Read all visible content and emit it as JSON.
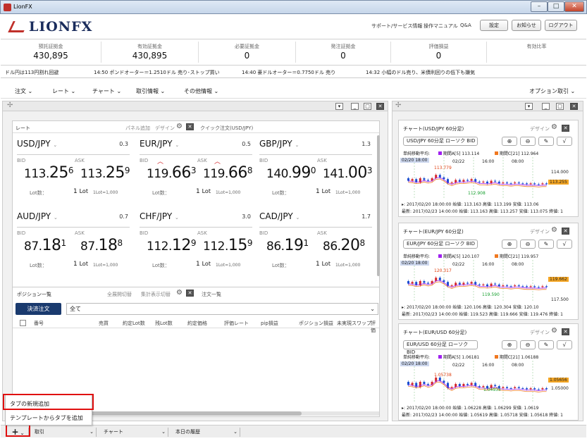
{
  "window": {
    "title": "LionFX"
  },
  "header": {
    "logo": "LIONFX",
    "links": [
      "サポート/サービス情報",
      "操作マニュアル",
      "Q&A"
    ],
    "buttons": [
      "設定",
      "お知らせ",
      "ログアウト"
    ]
  },
  "summary": [
    {
      "label": "預託証拠金",
      "value": "430,895"
    },
    {
      "label": "有効証拠金",
      "value": "430,895"
    },
    {
      "label": "必要証拠金",
      "value": "0"
    },
    {
      "label": "発注証拠金",
      "value": "0"
    },
    {
      "label": "評価損益",
      "value": "0"
    },
    {
      "label": "有効比率",
      "value": ""
    }
  ],
  "ticker": [
    "ドル円は113円割れ回避",
    "14:50  ポンドオーター＝1.2510ドル 売り･ストップ買い",
    "14:40  豪ドルオーター＝0.7750ドル 売り",
    "14:32  小幅のドル売り、米債利回りの低下も嫌気"
  ],
  "menu": {
    "items": [
      "注文",
      "レート",
      "チャート",
      "取引情報",
      "その他情報"
    ],
    "right": "オプション取引"
  },
  "rate_panel": {
    "title": "レート",
    "add": "パネル追加",
    "design": "デザイン",
    "quick": "クイック注文(USD/JPY)"
  },
  "rates": [
    {
      "pair": "USD/JPY",
      "spread": "0.3",
      "bid_main": "113.",
      "bid_big": "25",
      "bid_sup": "6",
      "ask_main": "113.",
      "ask_big": "25",
      "ask_sup": "9",
      "lot": "1",
      "lot_unit": "1Lot=1,000",
      "up": false
    },
    {
      "pair": "EUR/JPY",
      "spread": "0.5",
      "bid_main": "119.",
      "bid_big": "66",
      "bid_sup": "3",
      "ask_main": "119.",
      "ask_big": "66",
      "ask_sup": "8",
      "lot": "1",
      "lot_unit": "1Lot=1,000",
      "up": true
    },
    {
      "pair": "GBP/JPY",
      "spread": "1.3",
      "bid_main": "140.",
      "bid_big": "99",
      "bid_sup": "0",
      "ask_main": "141.",
      "ask_big": "00",
      "ask_sup": "3",
      "lot": "1",
      "lot_unit": "1Lot=1,000",
      "up": false
    },
    {
      "pair": "AUD/JPY",
      "spread": "0.7",
      "bid_main": "87.",
      "bid_big": "18",
      "bid_sup": "1",
      "ask_main": "87.",
      "ask_big": "18",
      "ask_sup": "8",
      "lot": "1",
      "lot_unit": "1Lot=1,000",
      "up": false
    },
    {
      "pair": "CHF/JPY",
      "spread": "3.0",
      "bid_main": "112.",
      "bid_big": "12",
      "bid_sup": "9",
      "ask_main": "112.",
      "ask_big": "15",
      "ask_sup": "9",
      "lot": "1",
      "lot_unit": "1Lot=1,000",
      "up": false
    },
    {
      "pair": "CAD/JPY",
      "spread": "1.7",
      "bid_main": "86.",
      "bid_big": "19",
      "bid_sup": "1",
      "ask_main": "86.",
      "ask_big": "20",
      "ask_sup": "8",
      "lot": "1",
      "lot_unit": "1Lot=1,000",
      "up": false
    }
  ],
  "labels": {
    "bid": "BID",
    "ask": "ASK",
    "lot": "Lot数：",
    "lot_suffix": "Lot"
  },
  "positions": {
    "title": "ポジション一覧",
    "open_all": "全展開切替",
    "total": "集計表示切替",
    "orders": "注文一覧",
    "settle": "決済注文",
    "filter": "全て",
    "columns": [
      "番号",
      "売買",
      "約定Lot数",
      "残Lot数",
      "約定価格",
      "評価レート",
      "pip損益",
      "ポジション損益",
      "未実現スワップ",
      "評価"
    ]
  },
  "charts": [
    {
      "title": "チャート(USD/JPY 60分足)",
      "design": "デザイン",
      "select": "USD/JPY 60分足 ローソク BID",
      "legend_ma": "単純移動平均:",
      "ma5": "期間A[5] 113.114",
      "ma21": "期間C[21] 112.964",
      "date": "02/20 18:00",
      "ticks": [
        "02/22",
        "16:00",
        "08:00"
      ],
      "price_hi": "114.000",
      "price_cur": "113.255",
      "price_lo": "",
      "peak": "113.779",
      "trough": "112.908",
      "row1": "▸: 2017/02/20 18:00:00 始値: 113.163 高値: 113.199 安値: 113.06",
      "row2": "最新: 2017/02/23 14:00:00 始値: 113.163 高値: 113.257 安値: 113.075 終値: 1"
    },
    {
      "title": "チャート(EUR/JPY 60分足)",
      "design": "デザイン",
      "select": "EUR/JPY 60分足 ローソク BID",
      "legend_ma": "単純移動平均:",
      "ma5": "期間A[5] 120.107",
      "ma21": "期間C[21] 119.957",
      "date": "02/20 18:00",
      "ticks": [
        "02/22",
        "16:00",
        "08:00"
      ],
      "price_hi": "",
      "price_cur": "119.662",
      "price_lo": "117.500",
      "peak": "120.317",
      "trough": "119.590",
      "row1": "▸: 2017/02/20 18:00:00 始値: 120.106 高値: 120.304 安値: 120.10",
      "row2": "最新: 2017/02/23 14:00:00 始値: 119.523 高値: 119.666 安値: 119.476 終値: 1"
    },
    {
      "title": "チャート(EUR/USD 60分足)",
      "design": "デザイン",
      "select": "EUR/USD 60分足 ローソク BID",
      "legend_ma": "単純移動平均:",
      "ma5": "期間A[5] 1.06181",
      "ma21": "期間C[21] 1.06188",
      "date": "02/20 18:00",
      "ticks": [
        "02/22",
        "16:00",
        "08:00"
      ],
      "price_hi": "",
      "price_cur": "1.05656",
      "price_lo": "1.05000",
      "peak": "1.05738",
      "trough": "1.04935",
      "row1": "▸: 2017/02/20 18:00:00 始値: 1.06228 高値: 1.06299 安値: 1.0619",
      "row2": "最新: 2017/02/23 14:00:00 始値: 1.05619 高値: 1.05718 安値: 1.05618 終値: 1"
    }
  ],
  "popup": {
    "items": [
      "タブの新規追加",
      "テンプレートからタブを追加"
    ]
  },
  "tabs": {
    "add": "+",
    "items": [
      "取引",
      "チャート",
      "本日の履歴"
    ]
  },
  "colors": {
    "accent": "#1a3a6e",
    "red": "#e01010",
    "ma5": "#a020f0",
    "ma21": "#f07820",
    "bull": "#d3262a",
    "bear": "#1a4fd0"
  }
}
